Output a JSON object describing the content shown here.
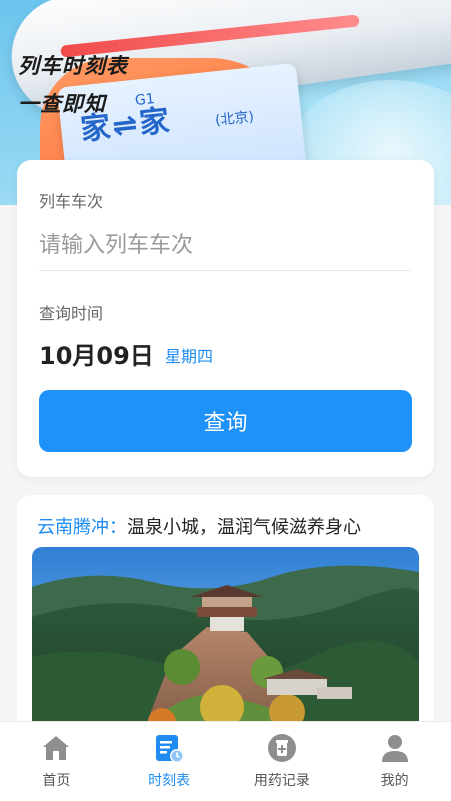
{
  "hero": {
    "title_line1": "列车时刻表",
    "title_line2": "一查即知",
    "ticket_main": "家⇌家",
    "ticket_code": "G1",
    "ticket_sub": "(北京)"
  },
  "search": {
    "train_label": "列车车次",
    "train_placeholder": "请输入列车车次",
    "time_label": "查询时间",
    "date": "10月09日",
    "weekday": "星期四",
    "submit_label": "查询"
  },
  "destination": {
    "place": "云南腾冲：",
    "desc": "温泉小城，温润气候滋养身心"
  },
  "nav": {
    "items": [
      {
        "label": "首页",
        "icon": "home-icon",
        "active": false
      },
      {
        "label": "时刻表",
        "icon": "timetable-icon",
        "active": true
      },
      {
        "label": "用药记录",
        "icon": "medicine-icon",
        "active": false
      },
      {
        "label": "我的",
        "icon": "profile-icon",
        "active": false
      }
    ]
  },
  "colors": {
    "accent": "#1e92f8",
    "accent_text": "#1e8cf0",
    "inactive_icon": "#8e8e8e"
  }
}
